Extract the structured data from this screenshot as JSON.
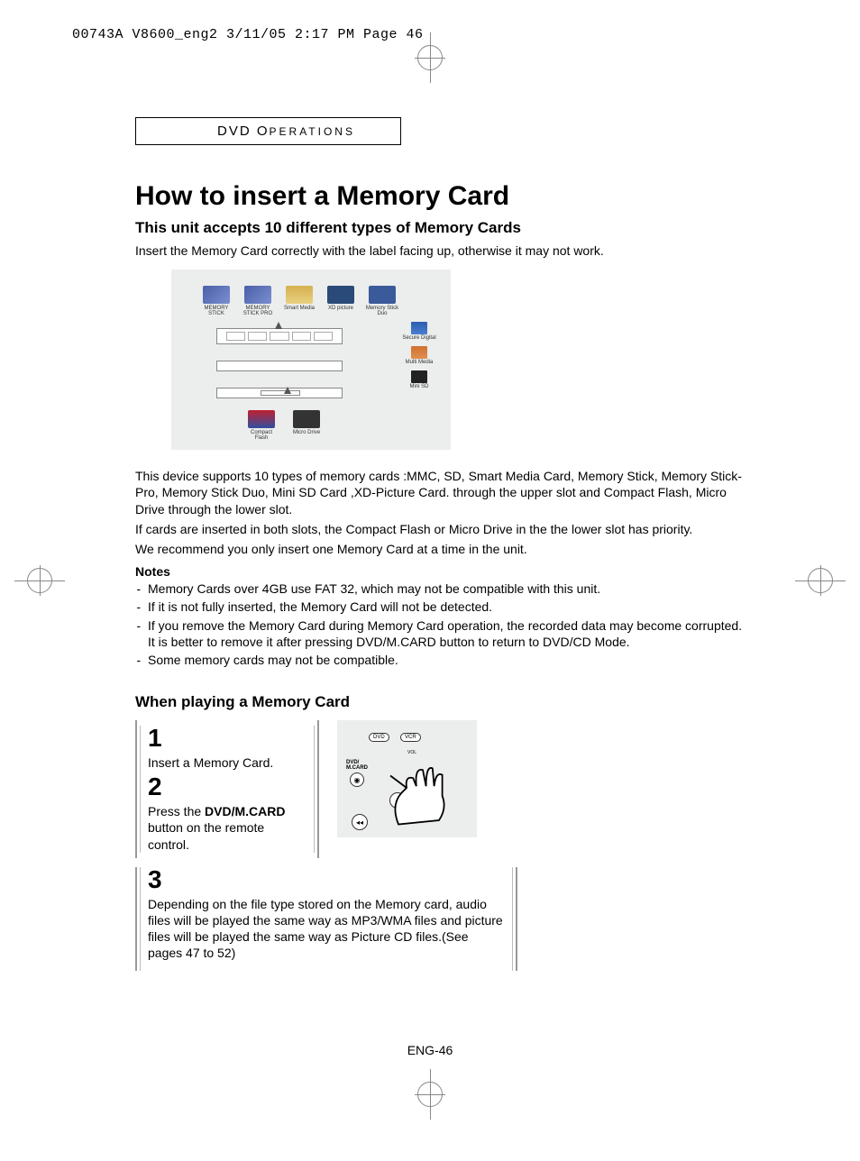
{
  "print_header": "00743A V8600_eng2  3/11/05  2:17 PM  Page 46",
  "section_label": "DVD O",
  "section_label_small": "PERATIONS",
  "title": "How to insert a Memory Card",
  "accepts_heading": "This unit accepts 10 different types of Memory Cards",
  "insert_label_up": "Insert the Memory Card correctly with the label facing up, otherwise it may not work.",
  "cards_top": [
    {
      "label": "MEMORY STICK"
    },
    {
      "label": "MEMORY STICK PRO"
    },
    {
      "label": "Smart Media"
    },
    {
      "label": "XD picture"
    },
    {
      "label": "Memory Stick Duo"
    }
  ],
  "cards_right": [
    {
      "label": "Secure Digital"
    },
    {
      "label": "Multi Media"
    },
    {
      "label": "Mini SD"
    }
  ],
  "cards_bottom": [
    {
      "label": "Compact Flash"
    },
    {
      "label": "Micro Drive"
    }
  ],
  "para1": "This device supports 10 types of memory cards :MMC, SD, Smart Media Card, Memory Stick, Memory Stick-Pro, Memory Stick Duo, Mini SD Card ,XD-Picture Card. through the upper slot and Compact Flash, Micro Drive through the lower slot.",
  "para2": "If cards are inserted in both slots, the Compact Flash or Micro Drive in the the lower slot has priority.",
  "para3": "We recommend you only insert one Memory Card at a time in the unit.",
  "notes_h": "Notes",
  "notes": [
    "Memory Cards over 4GB use FAT 32, which may not be compatible with this unit.",
    "If it is not fully inserted, the Memory Card will not be detected.",
    "If you remove the Memory Card during Memory Card operation, the recorded data may become corrupted. It is better to remove it after pressing DVD/M.CARD button to return to DVD/CD Mode.",
    "Some memory cards may not be compatible."
  ],
  "playing_h": "When playing a Memory Card",
  "step1_num": "1",
  "step1_text": "Insert a Memory Card.",
  "step2_num": "2",
  "step2_text_a": "Press the ",
  "step2_bold": "DVD/M.CARD",
  "step2_text_b": " button on the remote control.",
  "remote": {
    "dvd": "DVD",
    "vcr": "VCR",
    "vol": "VOL",
    "dvd_mcard": "DVD/\nM.CARD"
  },
  "step3_num": "3",
  "step3_text": "Depending on the file type stored on the Memory card, audio files will be played the same way as MP3/WMA files and picture files will be played the same way as Picture CD files.(See pages 47 to 52)",
  "page_num": "ENG-46"
}
